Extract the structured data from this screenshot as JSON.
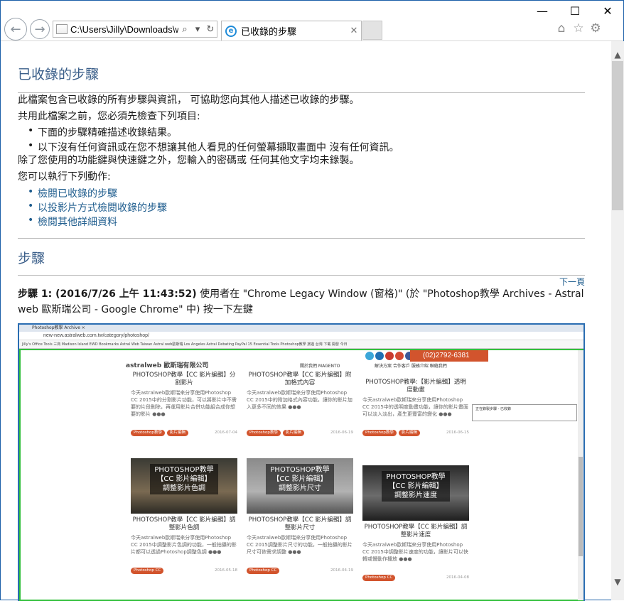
{
  "window": {
    "minimize": "—",
    "maximize": "☐",
    "close": "✕"
  },
  "address_bar": {
    "url": "C:\\Users\\Jilly\\Downloads\\w",
    "search_icon": "search-icon",
    "dropdown_icon": "chevron-down-icon",
    "refresh_icon": "refresh-icon"
  },
  "tab": {
    "title": "已收錄的步驟",
    "close": "✕"
  },
  "toolbar_icons": [
    "home-icon",
    "star-icon",
    "gear-icon"
  ],
  "page": {
    "heading": "已收錄的步驟",
    "intro": "此檔案包含已收錄的所有步驟與資訊， 可協助您向其他人描述已收錄的步驟。",
    "check_prompt": "共用此檔案之前，您必須先檢查下列項目:",
    "checks": [
      "下面的步驟精確描述收錄結果。",
      "以下沒有任何資訊或在您不想讓其他人看見的任何螢幕擷取畫面中 沒有任何資訊。"
    ],
    "note": "除了您使用的功能鍵與快速鍵之外，您輸入的密碼或 任何其他文字均未錄製。",
    "actions_prompt": "您可以執行下列動作:",
    "actions": [
      "檢閱已收錄的步驟",
      "以投影片方式檢閱收錄的步驟",
      "檢閱其他詳細資料"
    ],
    "steps_heading": "步驟",
    "next_link": "下一頁",
    "step1_label": "步驟 1: (2016/7/26 上午 11:43:52)",
    "step1_text": " 使用者在 \"Chrome Legacy Window (窗格)\" (於 \"Photoshop教學 Archives - Astral web 歐斯瑞公司 - Google Chrome\" 中) 按一下左鍵"
  },
  "screenshot": {
    "tab_text": "Photoshop教學 Archive ×",
    "url": "new-new.astralweb.com.tw/category/photoshop/",
    "bookmarks": "Jilly's Office Tools  三商  Madison Island  EWD Bookmarks  Astral Web Taiwan  Astral web歐斯瑞  Los Angeles Astral  Debating PayPal  15 Essential Tools  Photoshop教學  旅遊  台灣  下載  開發  今日",
    "logo": "astralweb 歐斯瑞有限公司",
    "nav": "關於我們  MAGENTO",
    "nav2": "解決方案  合作客戶  服務介紹  聯絡我們",
    "phone": "(02)2792-6381",
    "popup": "正在錄製步驟 - 已收錄",
    "cards": [
      {
        "title": "PHOTOSHOP教學【CC 影片編輯】分割影片",
        "text": "今天astralweb歐斯瑞來分享使用Photoshop CC 2015中的分割影片功能，可以將影片中不需要的片段刪除，再運用影片合併功能組合成你想要的影片 ●●●",
        "tags": [
          "Photoshop教學",
          "影片編輯"
        ],
        "date": "2016-07-04"
      },
      {
        "title": "PHOTOSHOP教學【CC 影片編輯】附加格式內容",
        "text": "今天astralweb歐斯瑞來分享使用Photoshop CC 2015中的附加格式內容功能，讓你的影片加入更多不同的效果 ●●●",
        "tags": [
          "Photoshop教學",
          "影片編輯"
        ],
        "date": "2016-06-19"
      },
      {
        "title": "PHOTOSHOP教學:【影片編輯】透明度動畫",
        "text": "今天astralweb歐斯瑞來分享使用Photoshop CC 2015中的透明度動畫功能，讓你的影片畫面可以淡入淡出，產生更豐富的變化 ●●●",
        "tags": [
          "Photoshop教學",
          "影片編輯"
        ],
        "date": "2016-06-15"
      },
      {
        "title": "PHOTOSHOP教學【CC 影片編輯】調整影片色調",
        "text": "今天astralweb歐斯瑞來分享使用Photoshop CC 2015中調整影片色調的功能，一般拍攝的影片都可以透過Photoshop調整色調 ●●●",
        "tags": [
          "Photoshop CC"
        ],
        "date": "2016-05-18",
        "thumb": "PHOTOSHOP教學\n【CC 影片編輯】\n調整影片色調"
      },
      {
        "title": "PHOTOSHOP教學【CC 影片編輯】調整影片尺寸",
        "text": "今天astralweb歐斯瑞來分享使用Photoshop CC 2015調整影片尺寸的功能，一般拍攝的影片尺寸可依需求調整 ●●●",
        "tags": [
          "Photoshop CC"
        ],
        "date": "2016-04-19",
        "thumb": "PHOTOSHOP教學\n【CC 影片編輯】\n調整影片尺寸"
      },
      {
        "title": "PHOTOSHOP教學【CC 影片編輯】調整影片速度",
        "text": "今天astralweb歐斯瑞來分享使用Photoshop CC 2015中調整影片速度的功能，讓影片可以快轉或慢動作播放 ●●●",
        "tags": [
          "Photoshop CC"
        ],
        "date": "2016-04-08",
        "thumb": "PHOTOSHOP教學\n【CC 影片編輯】\n調整影片速度"
      }
    ]
  },
  "colors": {
    "accent": "#3b5f8a",
    "link": "#1f5d8e",
    "tag": "#d2542d",
    "highlight": "#32c03c",
    "frame": "#2a6db2"
  }
}
